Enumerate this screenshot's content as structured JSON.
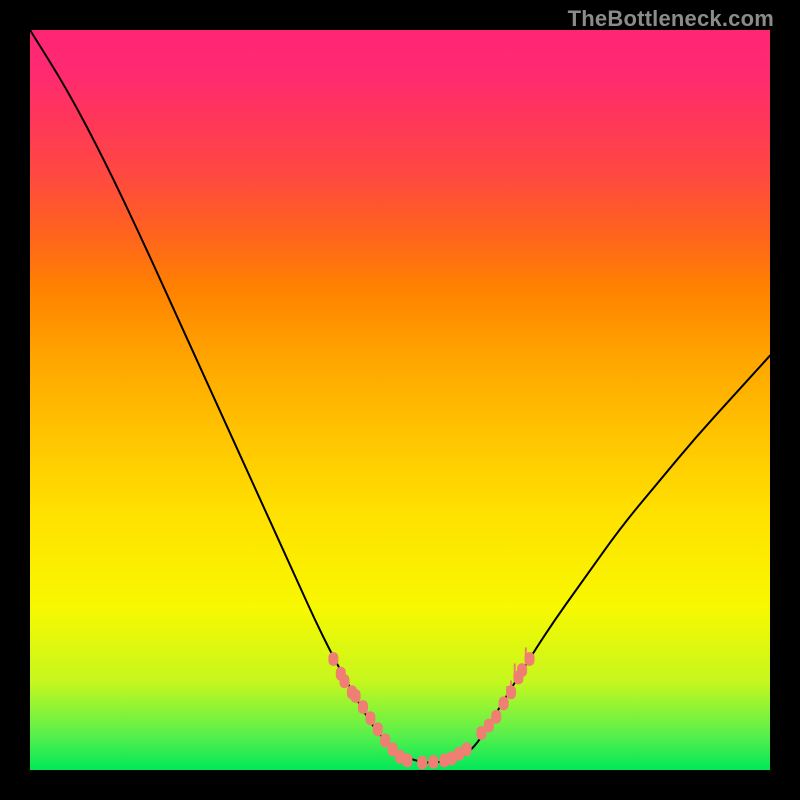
{
  "watermark": "TheBottleneck.com",
  "colors": {
    "background": "#000000",
    "curve": "#000000",
    "marker": "#ef7e73",
    "gradient_top": "#ff2575",
    "gradient_mid": "#ffe000",
    "gradient_bottom": "#00e85a"
  },
  "chart_data": {
    "type": "line",
    "title": "",
    "xlabel": "",
    "ylabel": "",
    "xlim": [
      0,
      100
    ],
    "ylim": [
      0,
      100
    ],
    "series": [
      {
        "name": "bottleneck-curve",
        "x": [
          0,
          5,
          10,
          15,
          20,
          25,
          30,
          35,
          40,
          45,
          47,
          50,
          53,
          55,
          58,
          60,
          62,
          65,
          70,
          75,
          80,
          85,
          90,
          95,
          100
        ],
        "values": [
          100,
          92,
          82.5,
          72,
          61,
          50,
          39,
          28,
          17,
          8,
          5,
          2,
          1,
          1,
          1.5,
          3,
          6,
          11,
          19,
          26,
          33,
          39,
          45,
          50.5,
          56
        ]
      }
    ],
    "annotations": {
      "markers": {
        "name": "edge-markers",
        "points": [
          {
            "x": 41,
            "y": 15
          },
          {
            "x": 42,
            "y": 13
          },
          {
            "x": 42.5,
            "y": 12
          },
          {
            "x": 43.5,
            "y": 10.5
          },
          {
            "x": 44,
            "y": 10
          },
          {
            "x": 45,
            "y": 8.5
          },
          {
            "x": 46,
            "y": 7
          },
          {
            "x": 47,
            "y": 5.5
          },
          {
            "x": 48,
            "y": 4
          },
          {
            "x": 49,
            "y": 2.8
          },
          {
            "x": 50,
            "y": 1.8
          },
          {
            "x": 51,
            "y": 1.3
          },
          {
            "x": 53,
            "y": 1
          },
          {
            "x": 54.5,
            "y": 1.1
          },
          {
            "x": 56,
            "y": 1.3
          },
          {
            "x": 57,
            "y": 1.6
          },
          {
            "x": 58,
            "y": 2.2
          },
          {
            "x": 59,
            "y": 2.8
          },
          {
            "x": 61,
            "y": 5
          },
          {
            "x": 62,
            "y": 6
          },
          {
            "x": 63,
            "y": 7.2
          },
          {
            "x": 64,
            "y": 9
          },
          {
            "x": 65,
            "y": 10.5
          },
          {
            "x": 66,
            "y": 12.5
          },
          {
            "x": 66.5,
            "y": 13.5
          },
          {
            "x": 67.5,
            "y": 15
          }
        ]
      }
    }
  }
}
